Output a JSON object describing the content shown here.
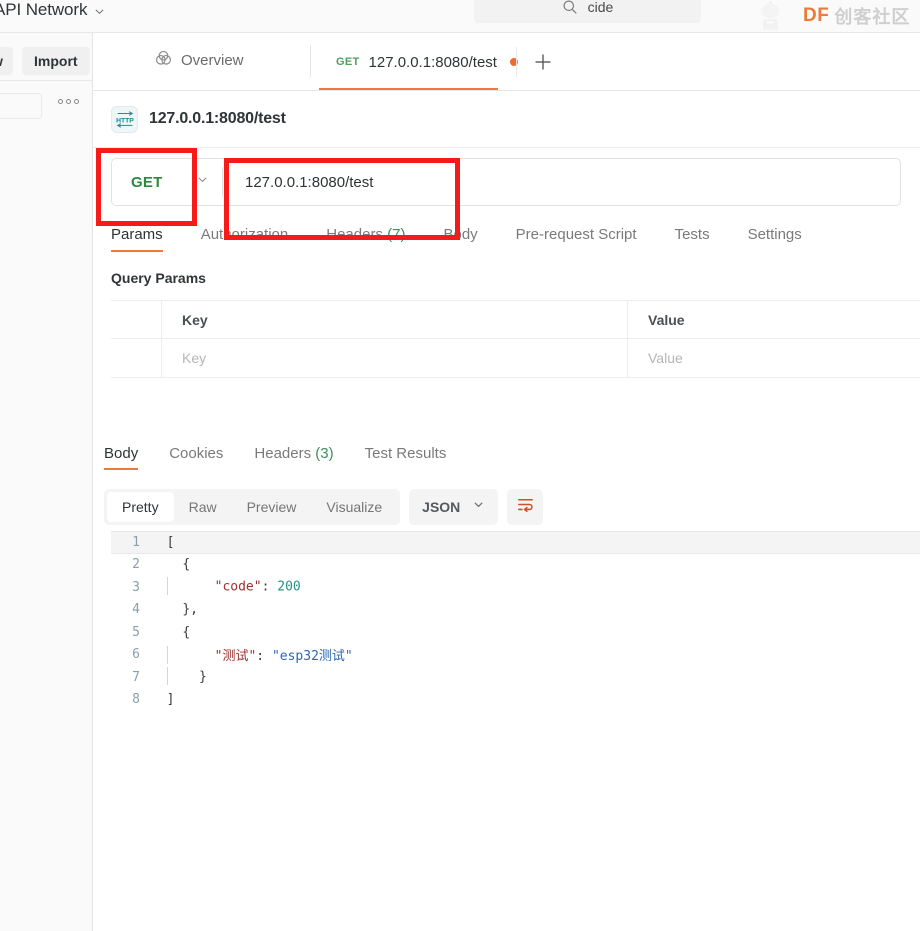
{
  "header": {
    "workspace_label": "API Network",
    "workspace_chevron_icon": "chevron-down-icon",
    "search": {
      "value": "cide",
      "icon": "search-icon"
    },
    "watermark": {
      "brand": "DF",
      "suffix": "创客社区",
      "logo_icon": "robot-logo-icon"
    }
  },
  "sidebar": {
    "new_button": "w",
    "import_button": "Import",
    "more_icon": "ellipsis-icon",
    "search_placeholder": ""
  },
  "tabbar": {
    "overview_label": "Overview",
    "overview_icon": "overview-circles-icon",
    "request_tab": {
      "method": "GET",
      "name": "127.0.0.1:8080/test",
      "unsaved_dot": "unsaved-dot"
    },
    "new_tab_icon": "plus-icon"
  },
  "request": {
    "protocol_icon": "http-icon",
    "title": "127.0.0.1:8080/test",
    "method": "GET",
    "method_chevron_icon": "chevron-down-icon",
    "url": "127.0.0.1:8080/test",
    "tabs": [
      {
        "label": "Params",
        "active": true
      },
      {
        "label": "Authorization",
        "active": false
      },
      {
        "label": "Headers",
        "count": "(7)",
        "active": false
      },
      {
        "label": "Body",
        "active": false
      },
      {
        "label": "Pre-request Script",
        "active": false
      },
      {
        "label": "Tests",
        "active": false
      },
      {
        "label": "Settings",
        "active": false
      }
    ],
    "query_params_title": "Query Params",
    "params_table": {
      "headers": {
        "key": "Key",
        "value": "Value"
      },
      "rows": [
        {
          "key_placeholder": "Key",
          "value_placeholder": "Value"
        }
      ]
    }
  },
  "response": {
    "tabs": [
      {
        "label": "Body",
        "active": true
      },
      {
        "label": "Cookies",
        "active": false
      },
      {
        "label": "Headers",
        "count": "(3)",
        "active": false
      },
      {
        "label": "Test Results",
        "active": false
      }
    ],
    "view_modes": [
      {
        "label": "Pretty",
        "active": true
      },
      {
        "label": "Raw",
        "active": false
      },
      {
        "label": "Preview",
        "active": false
      },
      {
        "label": "Visualize",
        "active": false
      }
    ],
    "format_select": {
      "value": "JSON",
      "chevron_icon": "chevron-down-icon"
    },
    "wrap_button_icon": "wrap-text-icon",
    "wrap_button_color": "#c8512a",
    "code_lines": [
      {
        "n": "1",
        "indent": 0,
        "guides": 0,
        "tokens": [
          {
            "t": "[",
            "c": "punct"
          }
        ],
        "active": true
      },
      {
        "n": "2",
        "indent": 1,
        "guides": 0,
        "tokens": [
          {
            "t": "{",
            "c": "punct"
          }
        ],
        "active": false
      },
      {
        "n": "3",
        "indent": 2,
        "guides": 1,
        "tokens": [
          {
            "t": "\"code\"",
            "c": "key"
          },
          {
            "t": ": ",
            "c": "punct"
          },
          {
            "t": "200",
            "c": "num"
          }
        ],
        "active": false
      },
      {
        "n": "4",
        "indent": 1,
        "guides": 0,
        "tokens": [
          {
            "t": "},",
            "c": "punct"
          }
        ],
        "active": false
      },
      {
        "n": "5",
        "indent": 1,
        "guides": 0,
        "tokens": [
          {
            "t": "{",
            "c": "punct"
          }
        ],
        "active": false
      },
      {
        "n": "6",
        "indent": 2,
        "guides": 1,
        "tokens": [
          {
            "t": "\"测试\"",
            "c": "key"
          },
          {
            "t": ": ",
            "c": "punct"
          },
          {
            "t": "\"esp32测试\"",
            "c": "str"
          }
        ],
        "active": false
      },
      {
        "n": "7",
        "indent": 1,
        "guides": 1,
        "tokens": [
          {
            "t": "}",
            "c": "punct"
          }
        ],
        "active": false
      },
      {
        "n": "8",
        "indent": 0,
        "guides": 0,
        "tokens": [
          {
            "t": "]",
            "c": "punct"
          }
        ],
        "active": false
      }
    ]
  },
  "annotations": {
    "color": "#f41b19",
    "boxes": [
      {
        "name": "method-highlight"
      },
      {
        "name": "url-highlight"
      }
    ]
  }
}
